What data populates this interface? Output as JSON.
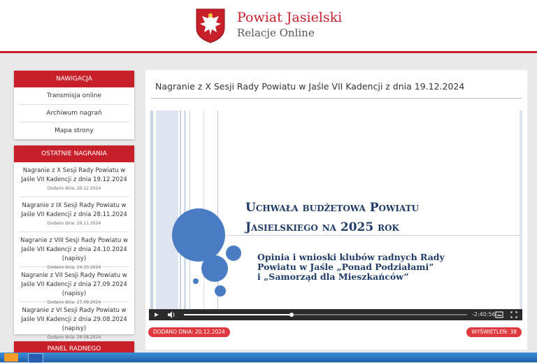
{
  "header": {
    "title": "Powiat Jasielski",
    "subtitle": "Relacje Online",
    "logo_icon": "coat-of-arms-eagle"
  },
  "nav": {
    "heading": "NAWIGACJA",
    "items": [
      {
        "label": "Transmisja online"
      },
      {
        "label": "Archiwum nagrań"
      },
      {
        "label": "Mapa strony"
      }
    ]
  },
  "recent": {
    "heading": "OSTATNIE NAGRANIA",
    "items": [
      {
        "title": "Nagranie z X Sesji Rady Powiatu w Jaśle VII Kadencji z dnia 19.12.2024",
        "date": "Dodano dnia: 20.12.2024"
      },
      {
        "title": "Nagranie z IX Sesji Rady Powiatu w Jaśle VII Kadencji z dnia 28.11.2024",
        "date": "Dodano dnia: 29.11.2024"
      },
      {
        "title": "Nagranie z VIII Sesji Rady Powiatu w Jaśle VII Kadencji z dnia 24.10.2024 (napisy)",
        "date": "Dodano dnia: 24.10.2024"
      },
      {
        "title": "Nagranie z VII Sesji Rady Powiatu w Jaśle VII Kadencji z dnia 27.09.2024 (napisy)",
        "date": "Dodano dnia: 27.09.2024"
      },
      {
        "title": "Nagranie z VI Sesji Rady Powiatu w Jaśle VII Kadencji z dnia 29.08.2024 (napisy)",
        "date": "Dodano dnia: 29.08.2024"
      }
    ]
  },
  "panel_radnego": {
    "heading": "PANEL RADNEGO"
  },
  "main": {
    "title": "Nagranie z X Sesji Rady Powiatu w Jaśle VII Kadencji z dnia 19.12.2024",
    "slide": {
      "heading_line1": "Uchwała budżetowa Powiatu",
      "heading_line2": "Jasielskiego na 2025 rok",
      "text_line1": "Opinia i wnioski klubów radnych Rady",
      "text_line2": "Powiatu w Jaśle „Ponad Podziałami”",
      "text_line3": "i „Samorząd dla Mieszkańców”"
    },
    "player": {
      "time_remaining": "-2:40:56",
      "progress_fraction": 0.38,
      "icons": [
        "play-icon",
        "volume-icon",
        "subtitles-icon",
        "fullscreen-icon"
      ]
    },
    "added_badge": "DODANO DNIA: 20.12.2024",
    "views_badge": "WYŚWIETLEŃ: 38"
  },
  "colors": {
    "accent": "#c8202b",
    "badge": "#e0383f",
    "slide_text": "#1f3b66",
    "circle": "#4a7cc4"
  }
}
